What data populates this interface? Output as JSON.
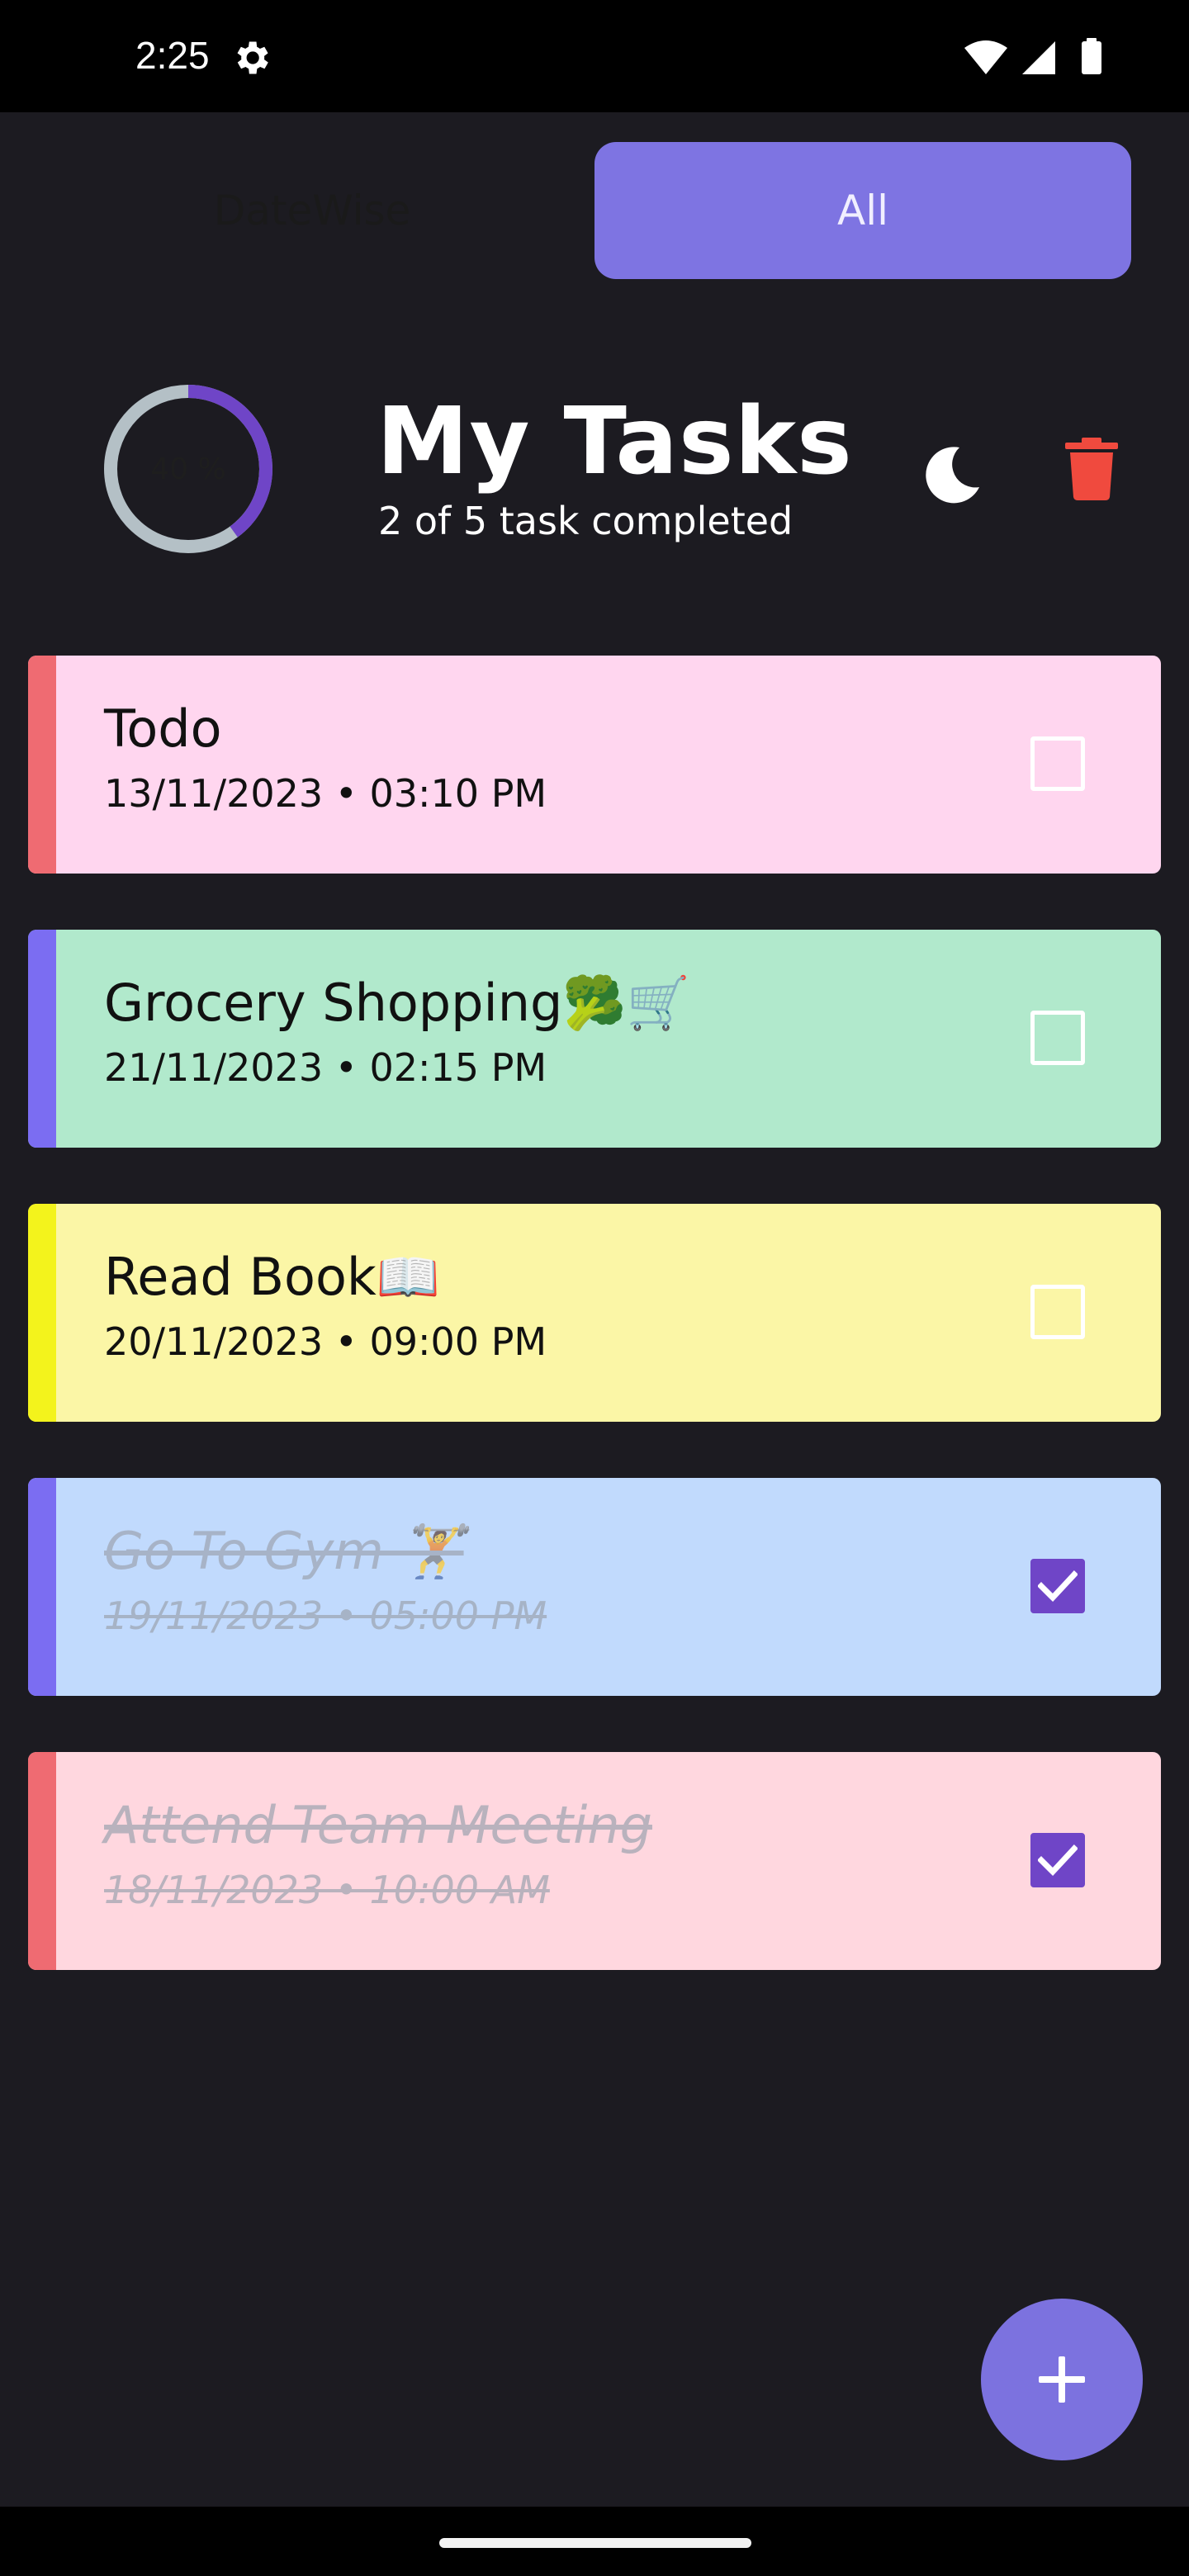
{
  "status_bar": {
    "time": "2:25"
  },
  "tabs": [
    {
      "label": "DateWise",
      "active": false
    },
    {
      "label": "All",
      "active": true
    }
  ],
  "header": {
    "progress_label": "40 %",
    "progress_fraction": 0.4,
    "title": "My Tasks",
    "subtitle": "2 of 5 task completed"
  },
  "tasks": [
    {
      "name": "Todo",
      "datetime": "13/11/2023 • 03:10 PM",
      "completed": false,
      "color": "#ffd6ef",
      "accent": "#ef6b72"
    },
    {
      "name": "Grocery Shopping🥦🛒",
      "datetime": "21/11/2023 • 02:15 PM",
      "completed": false,
      "color": "#b1e9cc",
      "accent": "#7b6df2"
    },
    {
      "name": "Read Book📖",
      "datetime": "20/11/2023 • 09:00 PM",
      "completed": false,
      "color": "#fbf6a6",
      "accent": "#f3f31c"
    },
    {
      "name": "Go To Gym 🏋",
      "datetime": "19/11/2023 • 05:00 PM",
      "completed": true,
      "color": "#c1dafd",
      "accent": "#7b6df2"
    },
    {
      "name": "Attend Team Meeting",
      "datetime": "18/11/2023 • 10:00 AM",
      "completed": true,
      "color": "#ffd7df",
      "accent": "#ef6b72"
    }
  ],
  "colors": {
    "accent": "#7e74e2",
    "progress_track": "#b4c0c6",
    "progress_fill": "#6f45c7",
    "delete": "#f04a3e"
  },
  "icons": {
    "settings": "gear-icon",
    "theme_toggle": "moon-icon",
    "delete": "trash-icon",
    "add": "plus-icon"
  }
}
